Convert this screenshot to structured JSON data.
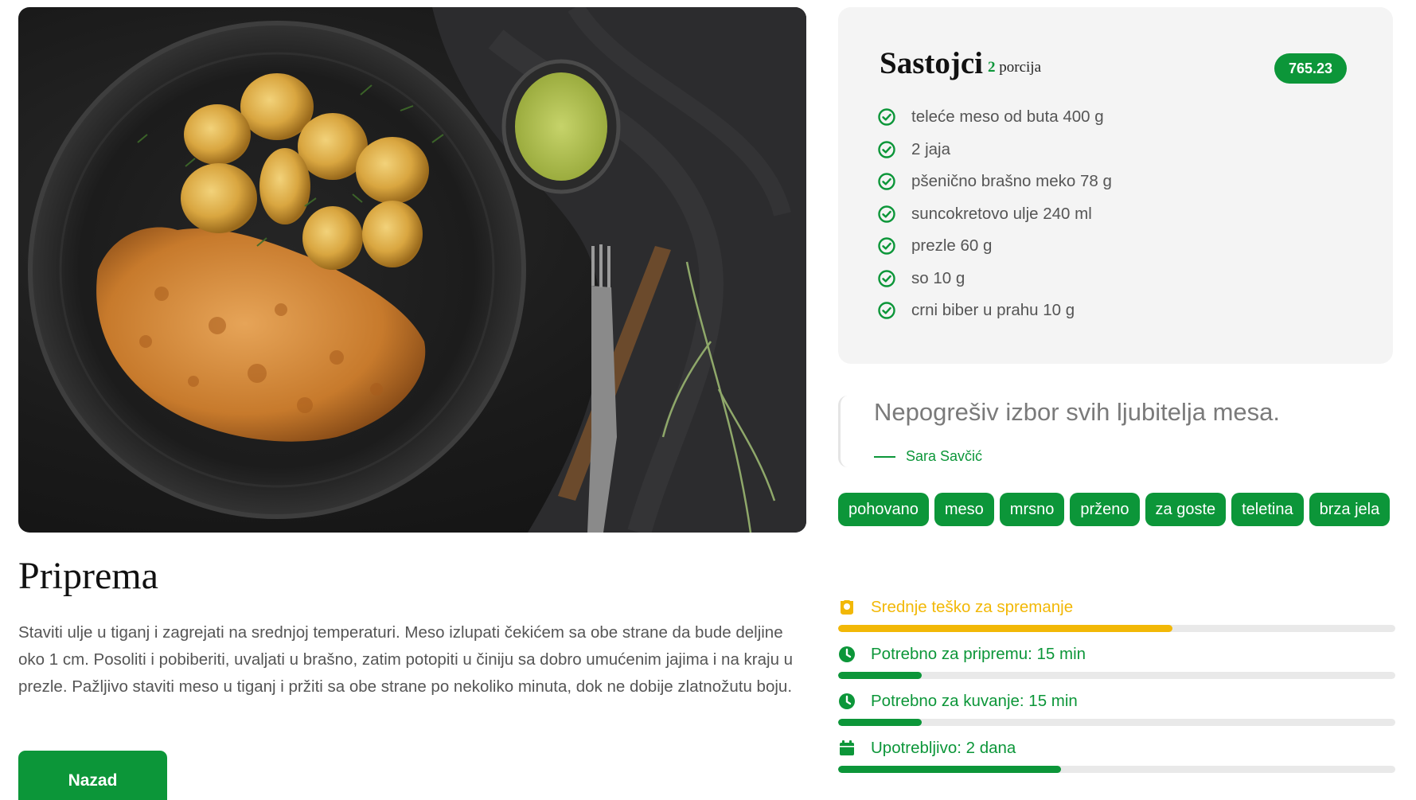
{
  "hero": {
    "alt": "pohovana teletina sa krompirom"
  },
  "preparation": {
    "title": "Priprema",
    "text": "Staviti ulje u tiganj i zagrejati na srednjoj temperaturi. Meso izlupati čekićem sa obe strane da bude deljine oko 1 cm. Posoliti i pobiberiti, uvaljati u brašno, zatim potopiti u činiju sa dobro umućenim jajima i na kraju u prezle. Pažljivo staviti meso u tiganj i pržiti sa obe strane po nekoliko minuta, dok ne dobije zlatnožutu boju.",
    "back_label": "Nazad"
  },
  "ingredients": {
    "title": "Sastojci",
    "portion_count": "2",
    "portion_label": "porcija",
    "price": "765.23",
    "items": [
      "teleće meso od buta 400 g",
      "2 jaja",
      "pšenično brašno meko 78 g",
      "suncokretovo ulje 240 ml",
      "prezle 60 g",
      "so 10 g",
      "crni biber u prahu 10 g"
    ]
  },
  "quote": {
    "text": "Nepogrešiv izbor svih ljubitelja mesa.",
    "author": "Sara Savčić"
  },
  "tags": [
    "pohovano",
    "meso",
    "mrsno",
    "prženo",
    "za goste",
    "teletina",
    "brza jela"
  ],
  "meters": [
    {
      "label": "Srednje teško za spremanje",
      "icon": "chef-hat-icon",
      "color": "#f2b807",
      "progress": 0.6
    },
    {
      "label": "Potrebno za pripremu: 15 min",
      "icon": "clock-icon",
      "color": "#0c9639",
      "progress": 0.15
    },
    {
      "label": "Potrebno za kuvanje: 15 min",
      "icon": "clock-icon",
      "color": "#0c9639",
      "progress": 0.15
    },
    {
      "label": "Upotrebljivo: 2 dana",
      "icon": "calendar-icon",
      "color": "#0c9639",
      "progress": 0.4
    }
  ],
  "colors": {
    "accent": "#0c9639",
    "warning": "#f2b807",
    "card_bg": "#f4f4f4"
  }
}
